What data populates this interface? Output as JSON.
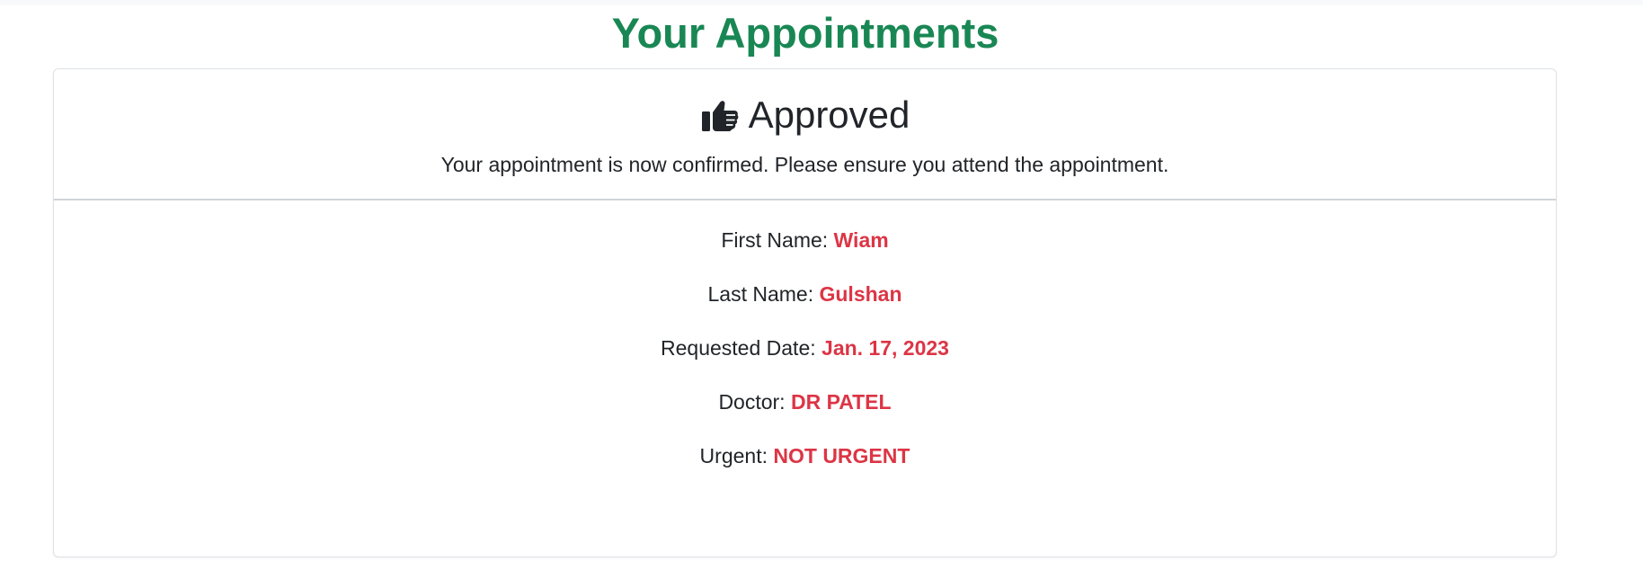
{
  "page": {
    "title": "Your Appointments"
  },
  "status": {
    "icon": "thumbs-up-icon",
    "title": "Approved",
    "message": "Your appointment is now confirmed. Please ensure you attend the appointment."
  },
  "details": {
    "first_name": {
      "label": "First Name:",
      "value": "Wiam"
    },
    "last_name": {
      "label": "Last Name:",
      "value": "Gulshan"
    },
    "requested_date": {
      "label": "Requested Date:",
      "value": "Jan. 17, 2023"
    },
    "doctor": {
      "label": "Doctor:",
      "value": "DR PATEL"
    },
    "urgent": {
      "label": "Urgent:",
      "value": "NOT URGENT"
    }
  },
  "colors": {
    "title_green": "#198754",
    "value_red": "#dc3545",
    "text_dark": "#212529"
  }
}
